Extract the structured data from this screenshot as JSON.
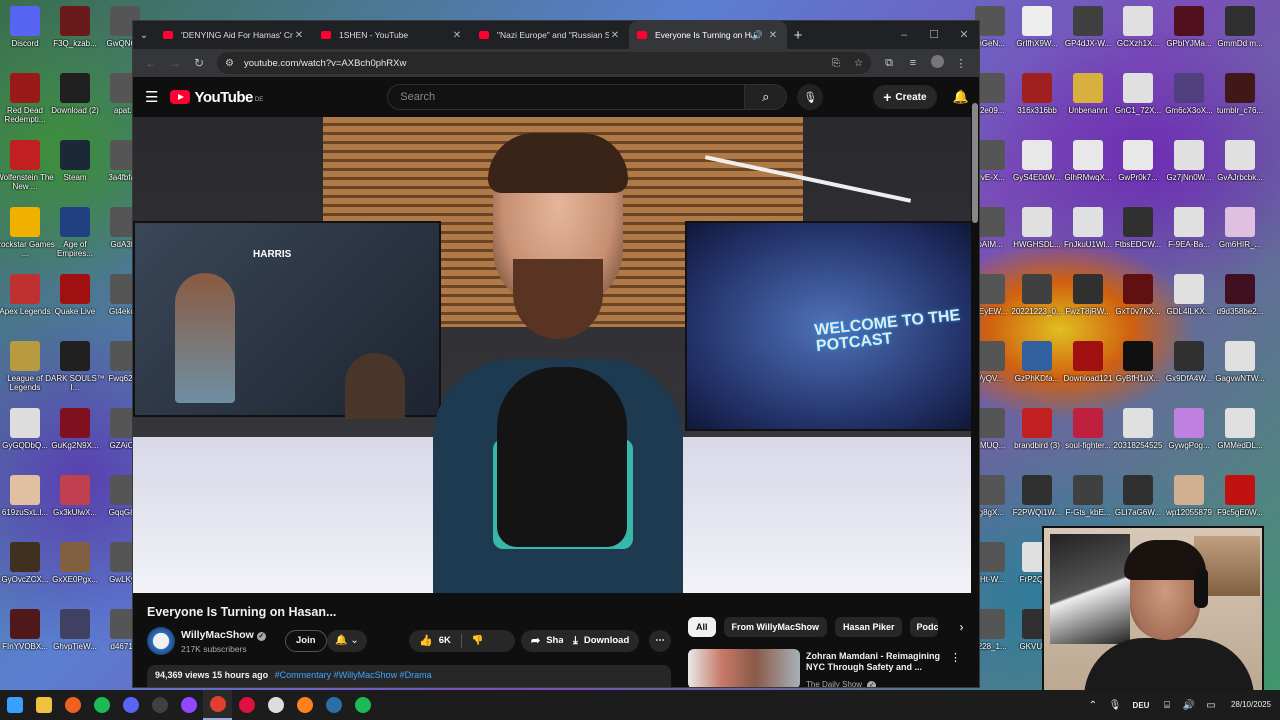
{
  "desktop": {
    "left_col1": [
      {
        "label": "Discord",
        "color": "#5865f2"
      },
      {
        "label": "Red Dead Redempti...",
        "color": "#9a1a1a"
      },
      {
        "label": "Wolfenstein The New ...",
        "color": "#c02020"
      },
      {
        "label": "Rockstar Games ...",
        "color": "#f0b000"
      },
      {
        "label": "Apex Legends",
        "color": "#c03030"
      },
      {
        "label": "League of Legends",
        "color": "#b89a40"
      },
      {
        "label": "GyGQDbQ...",
        "color": "#dddddd"
      },
      {
        "label": "619zuSxL.l...",
        "color": "#e0c0a0"
      },
      {
        "label": "GyOvcZCX...",
        "color": "#403020"
      },
      {
        "label": "FInYVOBX...",
        "color": "#501818"
      }
    ],
    "left_col2": [
      {
        "label": "F3Q_kzab...",
        "color": "#6a1a1a"
      },
      {
        "label": "Download (2)",
        "color": "#202020"
      },
      {
        "label": "Steam",
        "color": "#1b2838"
      },
      {
        "label": "Age of Empires...",
        "color": "#204080"
      },
      {
        "label": "Quake Live",
        "color": "#a01010"
      },
      {
        "label": "DARK SOULS™ I...",
        "color": "#202020"
      },
      {
        "label": "GuKg2N9X...",
        "color": "#801020"
      },
      {
        "label": "Gx3kUlwX...",
        "color": "#c04050"
      },
      {
        "label": "GxXE0Pgx...",
        "color": "#806040"
      },
      {
        "label": "GhvpTieW...",
        "color": "#404060"
      }
    ],
    "left_col3": [
      {
        "label": "GwQNG..."
      },
      {
        "label": "apat..."
      },
      {
        "label": "3a4fbfa..."
      },
      {
        "label": "GdA3f..."
      },
      {
        "label": "Gt4ekc..."
      },
      {
        "label": "Fwq62f..."
      },
      {
        "label": "GZAiO..."
      },
      {
        "label": "GqqG8..."
      },
      {
        "label": "GwLKy..."
      },
      {
        "label": "d4671..."
      }
    ],
    "right_col1": [
      {
        "label": "mGeN..."
      },
      {
        "label": "b2e09..."
      },
      {
        "label": "HvE-X..."
      },
      {
        "label": "bAIM..."
      },
      {
        "label": "GEyEW..."
      },
      {
        "label": "VyQV..."
      },
      {
        "label": "XMUQ..."
      },
      {
        "label": "rg8gX..."
      },
      {
        "label": "3Ht-W..."
      },
      {
        "label": "1228_1..."
      }
    ],
    "right_col2": [
      {
        "label": "GrIfhX9W...",
        "color": "#eeeeee"
      },
      {
        "label": "316x316bb",
        "color": "#a02020"
      },
      {
        "label": "GyS4E0dW...",
        "color": "#e8e8e8"
      },
      {
        "label": "HWGHSDL...",
        "color": "#e0e0e0"
      },
      {
        "label": "20221223_0...",
        "color": "#404040"
      },
      {
        "label": "GzPhKDfa...",
        "color": "#3060a0"
      },
      {
        "label": "brandbird (3)",
        "color": "#c02020"
      },
      {
        "label": "F2PWQi1W...",
        "color": "#303030"
      },
      {
        "label": "FrP2Qp...",
        "color": "#e0e0e0"
      },
      {
        "label": "GKVUC...",
        "color": "#303030"
      }
    ],
    "right_col3": [
      {
        "label": "GP4dJX-W...",
        "color": "#404040"
      },
      {
        "label": "Unbenannt",
        "color": "#d8b040"
      },
      {
        "label": "GlhRMwqX...",
        "color": "#e8e8e8"
      },
      {
        "label": "FnJkuU1Wl...",
        "color": "#e0e0e0"
      },
      {
        "label": "FwzT8jRW...",
        "color": "#303030"
      },
      {
        "label": "Download121",
        "color": "#a01010"
      },
      {
        "label": "soul-fighter...",
        "color": "#c02040"
      },
      {
        "label": "F-Gts_kbE...",
        "color": "#404040"
      }
    ],
    "right_col4": [
      {
        "label": "GCXzh1X...",
        "color": "#e0e0e0"
      },
      {
        "label": "GnC1_72X...",
        "color": "#e0e0e0"
      },
      {
        "label": "GwPr0k7...",
        "color": "#e8e8e8"
      },
      {
        "label": "FtbsEDCW...",
        "color": "#303030"
      },
      {
        "label": "GxT0v7KX...",
        "color": "#601010"
      },
      {
        "label": "GyBfH1uX...",
        "color": "#101010"
      },
      {
        "label": "20318254525",
        "color": "#e0e0e0"
      },
      {
        "label": "GLI7aG6W...",
        "color": "#303030"
      }
    ],
    "right_col5": [
      {
        "label": "GPbIYJMa...",
        "color": "#501020"
      },
      {
        "label": "Gm6cX3oX...",
        "color": "#504080"
      },
      {
        "label": "Gz7jNn0W...",
        "color": "#e0e0e0"
      },
      {
        "label": "F-9EA-Ba...",
        "color": "#e0e0e0"
      },
      {
        "label": "GDL4ILKX...",
        "color": "#e0e0e0"
      },
      {
        "label": "Gx9DfA4W...",
        "color": "#303030"
      },
      {
        "label": "GywgPog...",
        "color": "#c080e0"
      },
      {
        "label": "wp12055879",
        "color": "#d0b090"
      }
    ],
    "right_col6": [
      {
        "label": "GmmDd m...",
        "color": "#303030"
      },
      {
        "label": "tumblr_c76...",
        "color": "#401818"
      },
      {
        "label": "GvAJrbcbk...",
        "color": "#e0e0e0"
      },
      {
        "label": "Gm6HIR_...",
        "color": "#e0c0e0"
      },
      {
        "label": "d9d358be2...",
        "color": "#401020"
      },
      {
        "label": "GagvwNTW...",
        "color": "#e0e0e0"
      },
      {
        "label": "GMMedDL...",
        "color": "#e0e0e0"
      },
      {
        "label": "F9c5gE0W...",
        "color": "#c01010"
      }
    ]
  },
  "browser": {
    "tabs": [
      {
        "title": "'DENYING Aid For Hamas' Crim",
        "active": false
      },
      {
        "title": "1SHEN - YouTube",
        "active": false
      },
      {
        "title": "\"Nazi Europe\" and \"Russian Su",
        "active": false
      },
      {
        "title": "Everyone Is Turning on Has",
        "active": true
      }
    ],
    "url": "youtube.com/watch?v=AXBch0phRXw"
  },
  "youtube": {
    "logo_text": "YouTube",
    "country": "DE",
    "search_placeholder": "Search",
    "create_label": "Create",
    "video": {
      "screen_left_text": "HARRIS",
      "screen_right_text": "WELCOME TO THE POTCAST"
    },
    "title": "Everyone Is Turning on Hasan...",
    "channel": {
      "name": "WillyMacShow",
      "subscribers": "217K subscribers",
      "join_label": "Join"
    },
    "likes": "6K",
    "share_label": "Share",
    "download_label": "Download",
    "description": {
      "views": "94,369 views",
      "age": "15 hours ago",
      "tags": "#Commentary #WillyMacShow #Drama"
    },
    "chips": [
      "All",
      "From WillyMacShow",
      "Hasan Piker",
      "Podcasts"
    ],
    "recommendation": {
      "title": "Zohran Mamdani - Reimagining NYC Through Safety and ...",
      "channel": "The Daily Show"
    }
  },
  "taskbar": {
    "apps": [
      {
        "name": "windows-start",
        "color": "#3aa0ff"
      },
      {
        "name": "file-explorer",
        "color": "#f0c040"
      },
      {
        "name": "brave",
        "color": "#f06020"
      },
      {
        "name": "spotify",
        "color": "#1db954"
      },
      {
        "name": "discord",
        "color": "#5865f2"
      },
      {
        "name": "obs",
        "color": "#404040"
      },
      {
        "name": "twitch",
        "color": "#9146ff"
      },
      {
        "name": "chrome",
        "color": "#e04030"
      },
      {
        "name": "opera-gx",
        "color": "#e01040"
      },
      {
        "name": "unity",
        "color": "#dddddd"
      },
      {
        "name": "firefox",
        "color": "#ff8020"
      },
      {
        "name": "steam",
        "color": "#2a6fa8"
      },
      {
        "name": "spotify-2",
        "color": "#1db954"
      }
    ],
    "language": "DEU",
    "date": "28/10/2025"
  }
}
